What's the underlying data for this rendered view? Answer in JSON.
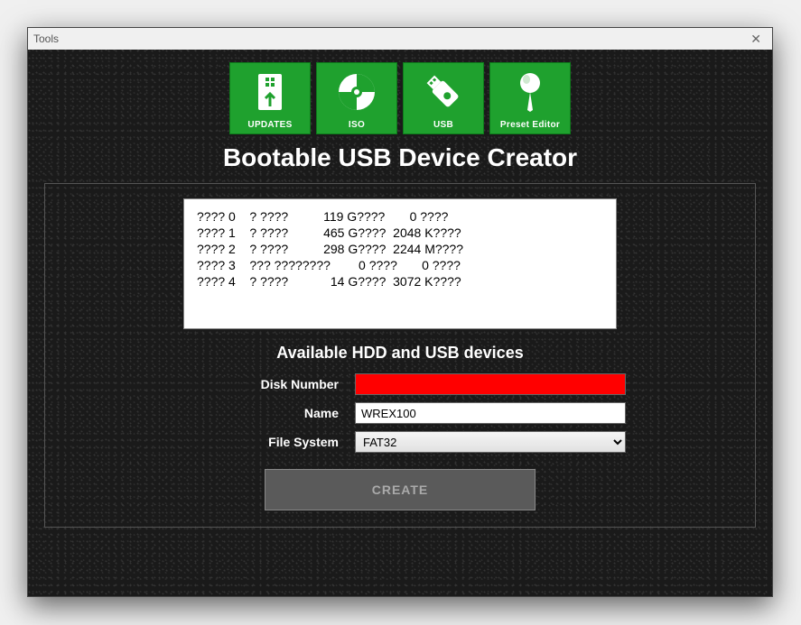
{
  "titlebar": {
    "menu": "Tools"
  },
  "tiles": {
    "updates": "UPDATES",
    "iso": "ISO",
    "usb": "USB",
    "preset": "Preset Editor"
  },
  "main_title": "Bootable USB Device Creator",
  "device_list": [
    "???? 0    ? ????          119 G????       0 ????",
    "???? 1    ? ????          465 G????  2048 K????",
    "???? 2    ? ????          298 G????  2244 M????",
    "???? 3    ??? ????????        0 ????       0 ????",
    "???? 4    ? ????            14 G????  3072 K????"
  ],
  "subhead": "Available HDD and USB devices",
  "form": {
    "disk_number_label": "Disk Number",
    "disk_number_value": "",
    "name_label": "Name",
    "name_value": "WREX100",
    "fs_label": "File System",
    "fs_value": "FAT32"
  },
  "create_label": "CREATE"
}
